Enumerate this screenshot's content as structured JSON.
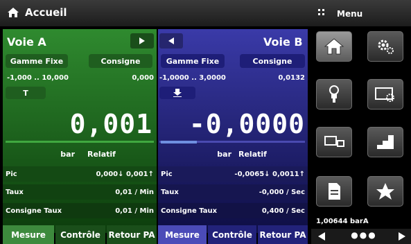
{
  "header": {
    "title": "Accueil",
    "menu_label": "Menu"
  },
  "channel_a": {
    "name": "Voie A",
    "range_button": "Gamme Fixe",
    "setpoint_button": "Consigne",
    "range_text": "-1,000 ..  10,000",
    "setpoint_value": "0,000",
    "small_button": "T",
    "reading": "0,001",
    "unit": "bar",
    "mode": "Relatif",
    "stats": [
      {
        "label": "Pic",
        "value": "0,000↓  0,001↑"
      },
      {
        "label": "Taux",
        "value": "0,01 / Min"
      },
      {
        "label": "Consigne Taux",
        "value": "0,01 / Min"
      }
    ]
  },
  "channel_b": {
    "name": "Voie B",
    "range_button": "Gamme Fixe",
    "setpoint_button": "Consigne",
    "range_text": "-1,0000 ..  3,0000",
    "setpoint_value": "0,0132",
    "reading": "-0,0000",
    "unit": "bar",
    "mode": "Relatif",
    "stats": [
      {
        "label": "Pic",
        "value": "-0,0065↓  0,0011↑"
      },
      {
        "label": "Taux",
        "value": "-0,000 / Sec"
      },
      {
        "label": "Consigne Taux",
        "value": "0,400 / Sec"
      }
    ]
  },
  "tabs_a": [
    "Mesure",
    "Contrôle",
    "Retour PA"
  ],
  "tabs_b": [
    "Mesure",
    "Contrôle",
    "Retour PA"
  ],
  "side": {
    "barometer_reading": "1,00644  barA",
    "dots": "●●●"
  },
  "icons": [
    "home-icon",
    "settings-icon",
    "sensor-icon",
    "display-settings-icon",
    "devices-icon",
    "step-icon",
    "document-icon",
    "star-icon"
  ],
  "colors": {
    "channel_a": "#2f8a2f",
    "channel_b": "#3a3aa8",
    "active_tab": "#3d8a3d"
  }
}
